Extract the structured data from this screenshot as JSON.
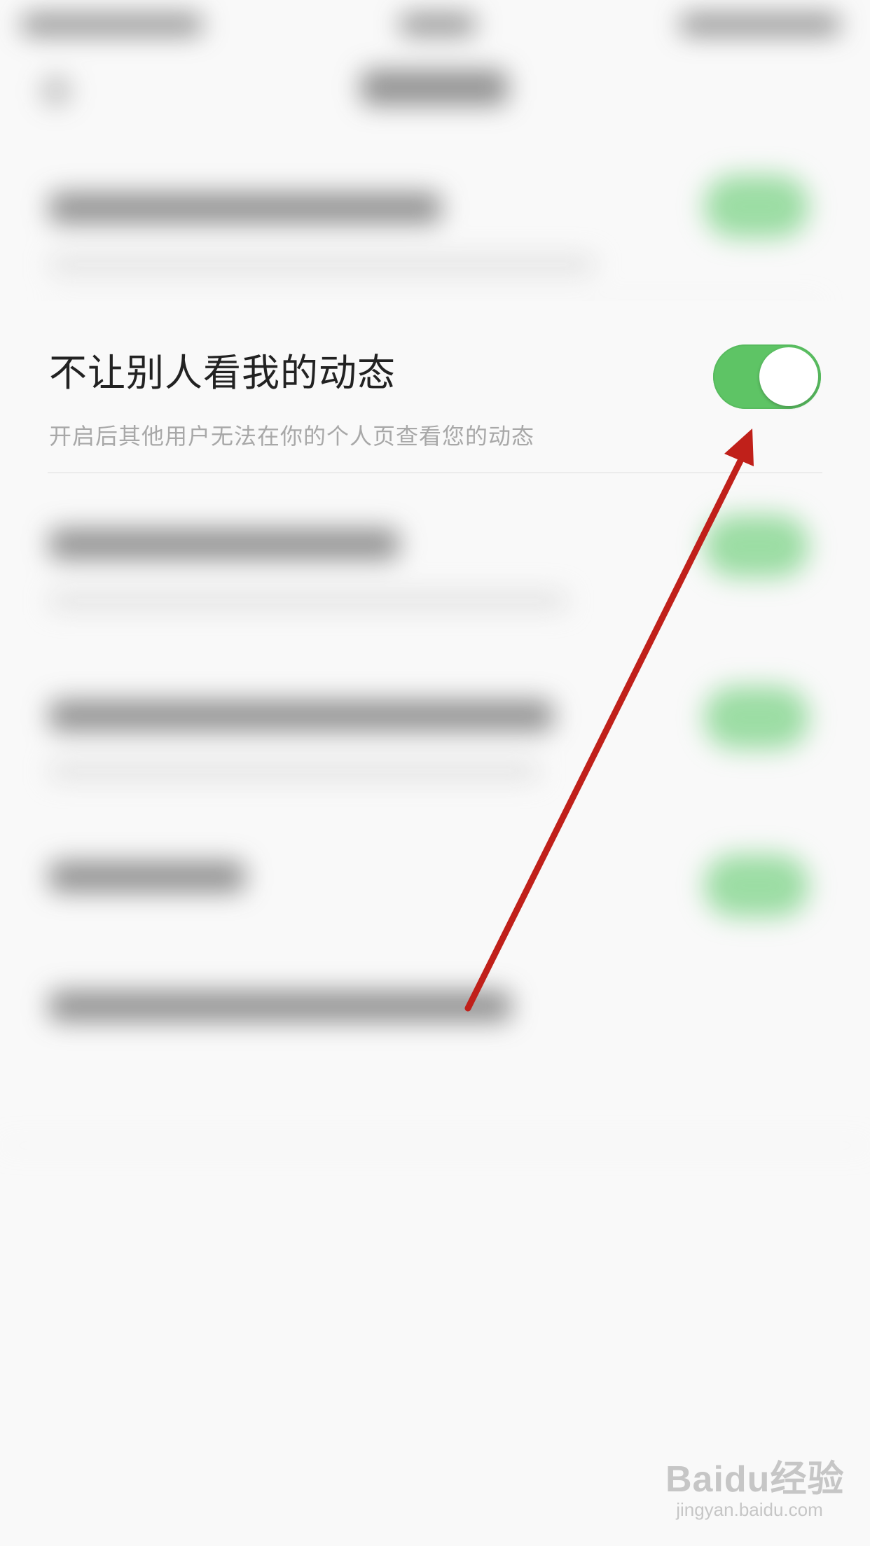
{
  "setting": {
    "title": "不让别人看我的动态",
    "subtitle": "开启后其他用户无法在你的个人页查看您的动态",
    "toggle_state": "on"
  },
  "colors": {
    "toggle_on": "#5ec465",
    "arrow": "#c0201a",
    "background": "#f9f9f9"
  },
  "watermark": {
    "logo": "Baidu经验",
    "url": "jingyan.baidu.com"
  }
}
